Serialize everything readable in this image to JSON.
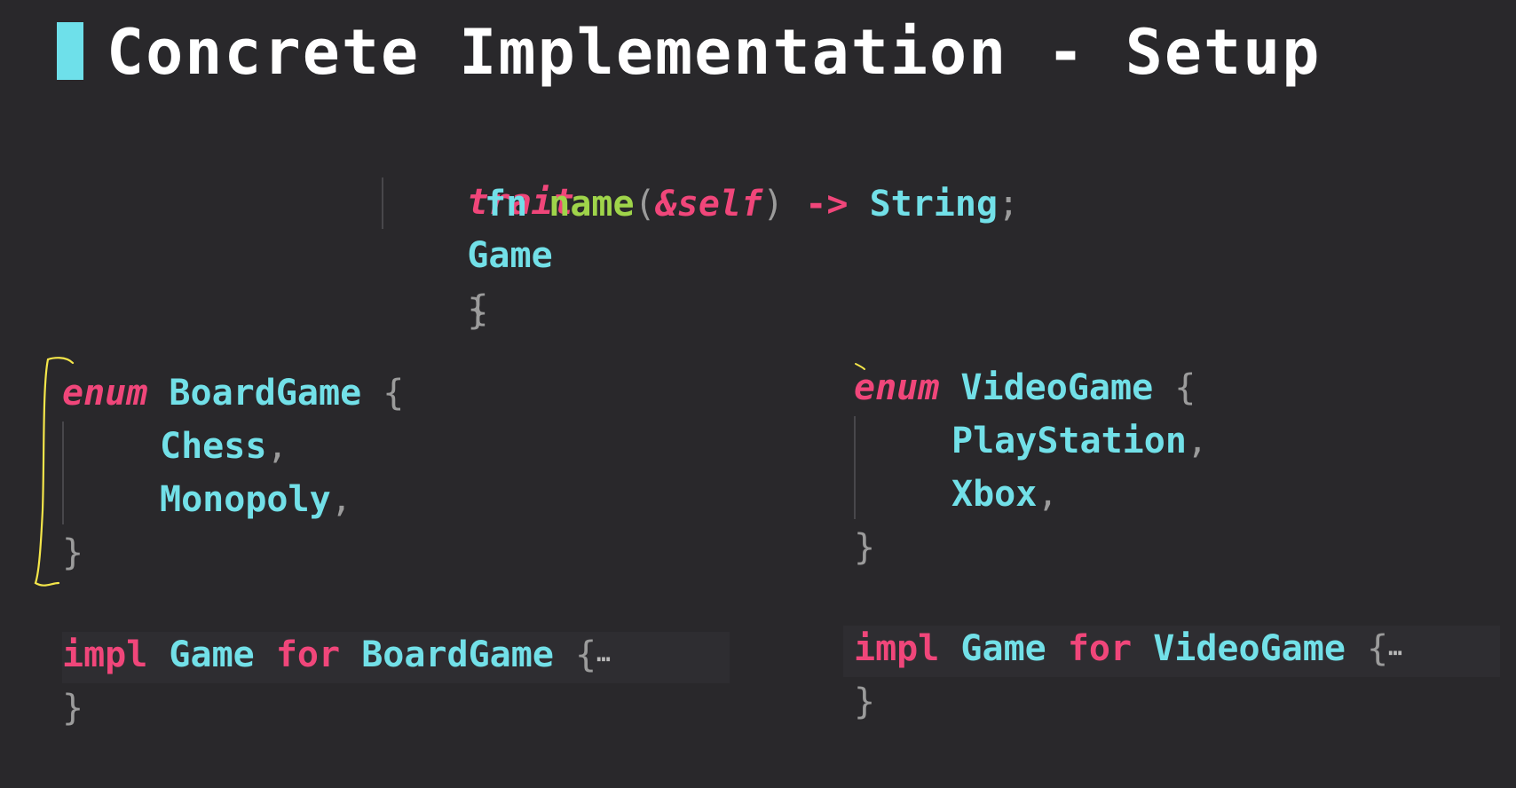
{
  "title": "Concrete Implementation - Setup",
  "trait_block": {
    "kw_trait": "trait",
    "name": "Game",
    "open": "{",
    "kw_fn": "fn",
    "fn_name": "name",
    "lparen": "(",
    "self_arg": "&self",
    "rparen": ")",
    "arrow": "->",
    "ret_type": "String",
    "semi": ";",
    "close": "}"
  },
  "board_enum": {
    "kw_enum": "enum",
    "name": "BoardGame",
    "open": "{",
    "variants": [
      "Chess",
      "Monopoly"
    ],
    "comma": ",",
    "close": "}"
  },
  "video_enum": {
    "kw_enum": "enum",
    "name": "VideoGame",
    "open": "{",
    "variants": [
      "PlayStation",
      "Xbox"
    ],
    "comma": ",",
    "close": "}"
  },
  "board_impl": {
    "kw_impl": "impl",
    "trait": "Game",
    "kw_for": "for",
    "target": "BoardGame",
    "open": "{",
    "ellipsis": "⋯",
    "close": "}"
  },
  "video_impl": {
    "kw_impl": "impl",
    "trait": "Game",
    "kw_for": "for",
    "target": "VideoGame",
    "open": "{",
    "ellipsis": "⋯",
    "close": "}"
  },
  "colors": {
    "background": "#29282b",
    "keyword": "#f0467a",
    "type": "#72e0e8",
    "function": "#9fd44a",
    "annotation": "#f4e64a"
  }
}
